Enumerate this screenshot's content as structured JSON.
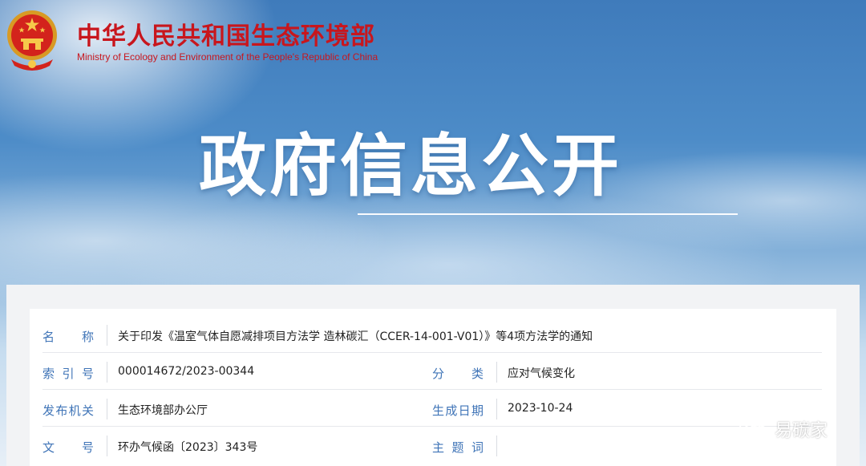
{
  "header": {
    "org_name_cn": "中华人民共和国生态环境部",
    "org_name_en": "Ministry of Ecology and Environment of the People's Republic of China",
    "emblem_icon": "national-emblem-icon"
  },
  "hero": {
    "title": "政府信息公开"
  },
  "info": {
    "name_label": "名 称",
    "name_value": "关于印发《温室气体自愿减排项目方法学 造林碳汇（CCER-14-001-V01）》等4项方法学的通知",
    "index_label": "索 引 号",
    "index_value": "000014672/2023-00344",
    "category_label": "分 类",
    "category_value": "应对气候变化",
    "issuer_label": "发布机关",
    "issuer_value": "生态环境部办公厅",
    "date_label": "生成日期",
    "date_value": "2023-10-24",
    "docno_label": "文 号",
    "docno_value": "环办气候函〔2023〕343号",
    "keywords_label": "主 题 词",
    "keywords_value": ""
  },
  "watermark": {
    "text": "易碳家",
    "icon": "wechat-icon"
  },
  "colors": {
    "brand_red": "#c8161d",
    "label_blue": "#3f74b7"
  }
}
